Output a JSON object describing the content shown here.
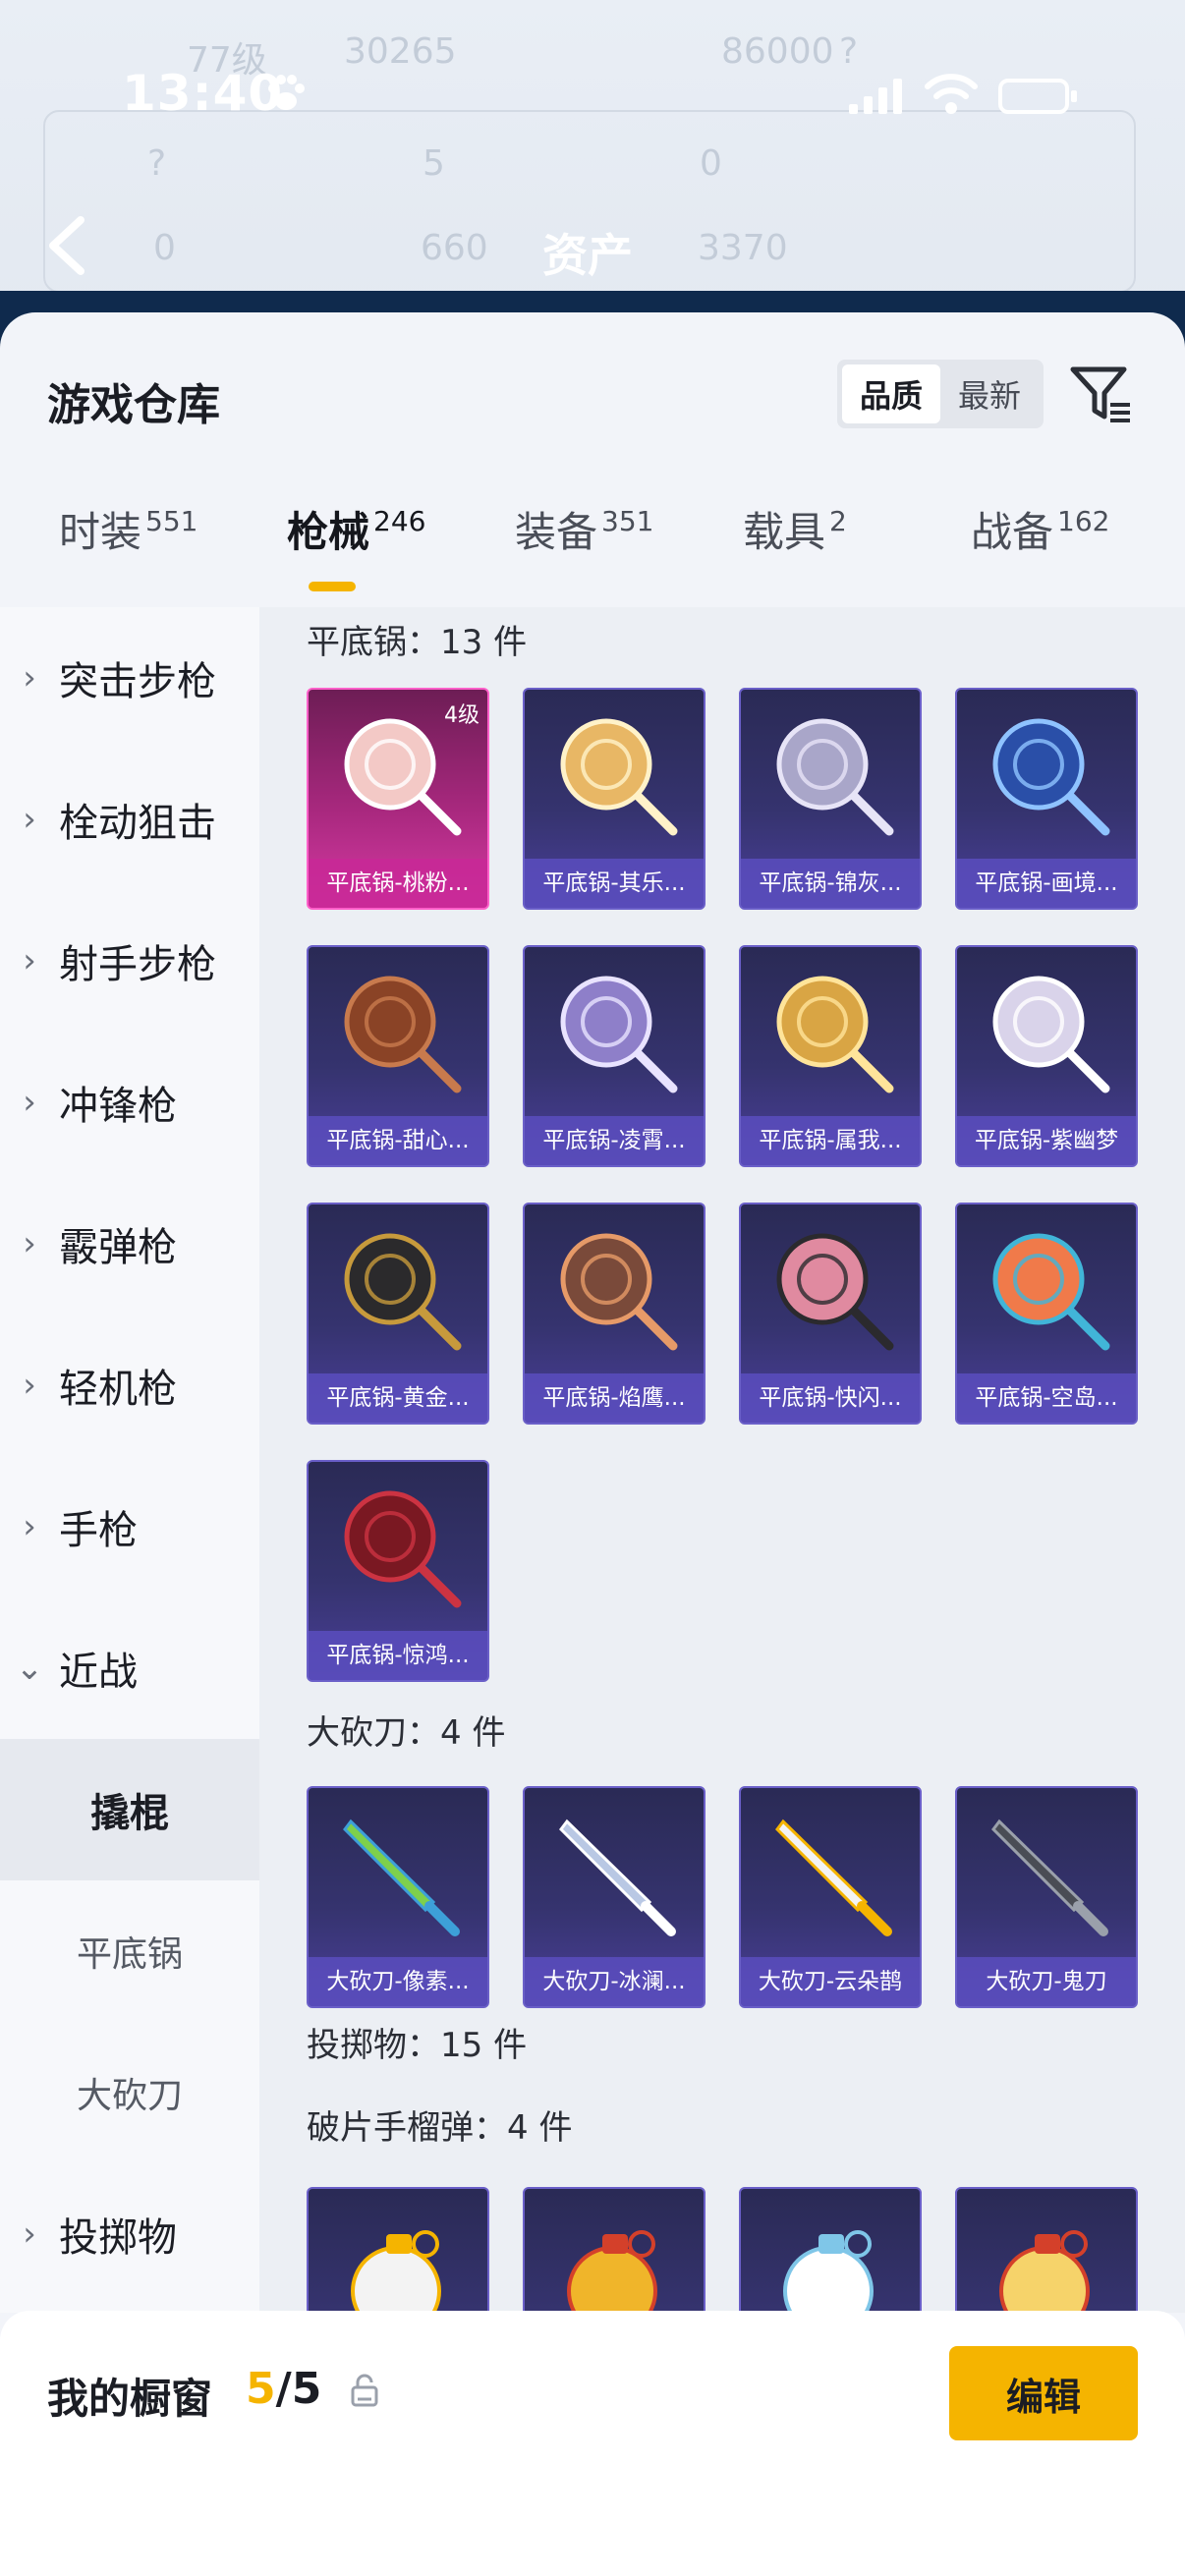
{
  "statusbar": {
    "time": "13:40"
  },
  "background": {
    "title": "资产",
    "ghost_texts": [
      "77级",
      "30265",
      "86000",
      "?",
      "0",
      "0",
      "660",
      "3370",
      "5",
      "0"
    ]
  },
  "sheet": {
    "title": "游戏仓库",
    "sort": {
      "options": [
        "品质",
        "最新"
      ],
      "active": "品质"
    },
    "tabs": [
      {
        "label": "时装",
        "count": "551"
      },
      {
        "label": "枪械",
        "count": "246"
      },
      {
        "label": "装备",
        "count": "351"
      },
      {
        "label": "载具",
        "count": "2"
      },
      {
        "label": "战备",
        "count": "162"
      }
    ],
    "active_tab": "枪械"
  },
  "sidebar": {
    "categories": [
      {
        "label": "突击步枪",
        "chevron": ">"
      },
      {
        "label": "栓动狙击",
        "chevron": ">"
      },
      {
        "label": "射手步枪",
        "chevron": ">"
      },
      {
        "label": "冲锋枪",
        "chevron": ">"
      },
      {
        "label": "霰弹枪",
        "chevron": ">"
      },
      {
        "label": "轻机枪",
        "chevron": ">"
      },
      {
        "label": "手枪",
        "chevron": ">"
      },
      {
        "label": "近战",
        "chevron": "v"
      }
    ],
    "subcategories": [
      {
        "label": "撬棍",
        "active": true
      },
      {
        "label": "平底锅",
        "active": false
      },
      {
        "label": "大砍刀",
        "active": false
      }
    ],
    "last_category": {
      "label": "投掷物",
      "chevron": ">"
    }
  },
  "content": {
    "sections": [
      {
        "title": "平底锅：13 件"
      },
      {
        "title": "大砍刀：4 件"
      },
      {
        "title": "投掷物：15 件"
      },
      {
        "title": "破片手榴弹：4 件"
      }
    ],
    "pans": [
      {
        "name": "平底锅-桃粉...",
        "level": "4级",
        "color": "#f3c9c6",
        "accent": "#ffffff",
        "rarity": "pink"
      },
      {
        "name": "平底锅-其乐...",
        "color": "#e8b765",
        "accent": "#fff2c9",
        "rarity": "purple"
      },
      {
        "name": "平底锅-锦灰...",
        "color": "#a9a6c9",
        "accent": "#e7e4f7",
        "rarity": "purple"
      },
      {
        "name": "平底锅-画境...",
        "color": "#2a4fa8",
        "accent": "#8fc3ff",
        "rarity": "purple"
      },
      {
        "name": "平底锅-甜心...",
        "color": "#8a4326",
        "accent": "#c87a4d",
        "rarity": "purple"
      },
      {
        "name": "平底锅-凌霄...",
        "color": "#8e7fc9",
        "accent": "#e9e3ff",
        "rarity": "purple"
      },
      {
        "name": "平底锅-属我...",
        "color": "#d9a544",
        "accent": "#ffe49a",
        "rarity": "purple"
      },
      {
        "name": "平底锅-紫幽梦",
        "color": "#d9d3ea",
        "accent": "#ffffff",
        "rarity": "purple"
      },
      {
        "name": "平底锅-黄金...",
        "color": "#2b2a2c",
        "accent": "#c79a3c",
        "rarity": "purple"
      },
      {
        "name": "平底锅-焰鹰...",
        "color": "#7a4a3a",
        "accent": "#e69a68",
        "rarity": "purple"
      },
      {
        "name": "平底锅-快闪...",
        "color": "#e08aa0",
        "accent": "#2b2a2e",
        "rarity": "purple"
      },
      {
        "name": "平底锅-空岛...",
        "color": "#f07a4a",
        "accent": "#41b5d8",
        "rarity": "purple"
      },
      {
        "name": "平底锅-惊鸿...",
        "color": "#7a1822",
        "accent": "#cc3342",
        "rarity": "purple"
      }
    ],
    "machetes": [
      {
        "name": "大砍刀-像素...",
        "color": "#7ed04c",
        "accent": "#3da0d8"
      },
      {
        "name": "大砍刀-冰澜...",
        "color": "#b9c8e4",
        "accent": "#ffffff"
      },
      {
        "name": "大砍刀-云朵鹊",
        "color": "#f4f4f4",
        "accent": "#f5b400"
      },
      {
        "name": "大砍刀-鬼刀",
        "color": "#4a4d55",
        "accent": "#9aa0ab"
      }
    ],
    "grenades": [
      {
        "color": "#f3f3f3",
        "accent": "#f5b400"
      },
      {
        "color": "#f0b52a",
        "accent": "#d4402a"
      },
      {
        "color": "#ffffff",
        "accent": "#7fc6e8"
      },
      {
        "color": "#f6d36a",
        "accent": "#d4402a"
      }
    ]
  },
  "bottom": {
    "title": "我的橱窗",
    "count_current": "5",
    "count_sep": "/",
    "count_total": "5",
    "edit_label": "编辑"
  },
  "colors": {
    "accent": "#f5b400",
    "card_purple": "#4a3f99",
    "card_pink": "#d63aa3"
  },
  "icons": {
    "back": "chevron-left-icon",
    "filter": "filter-icon",
    "share": "share-external-icon",
    "lock": "lock-icon"
  }
}
